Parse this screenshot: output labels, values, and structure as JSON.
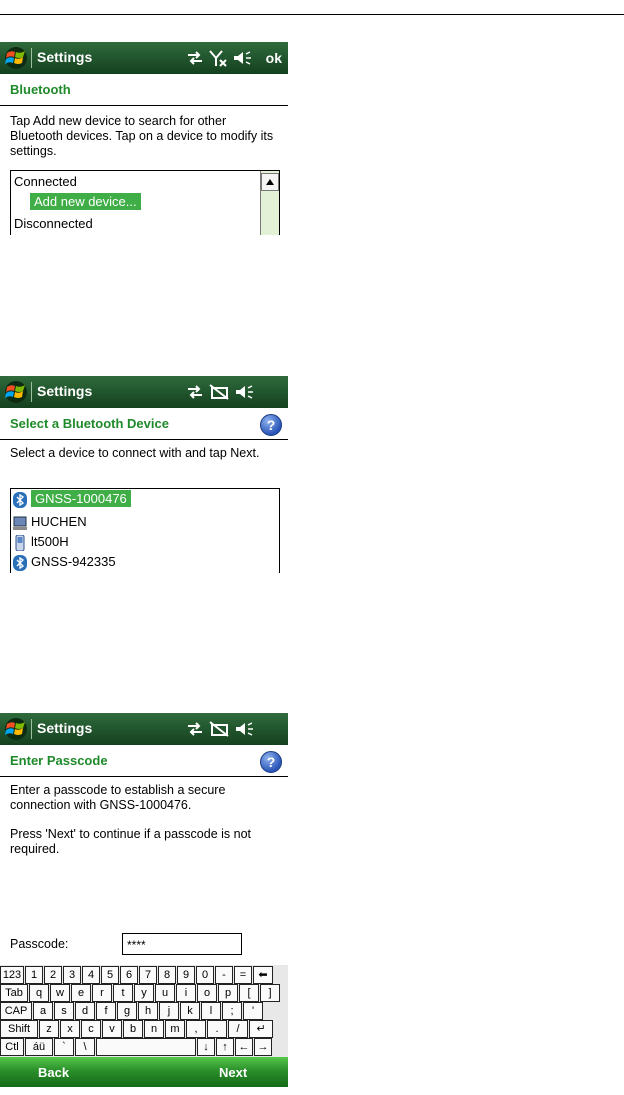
{
  "screens": {
    "bluetooth": {
      "title": "Settings",
      "ok_label": "ok",
      "heading": "Bluetooth",
      "instructions": "Tap Add new device to search for other Bluetooth devices. Tap on a device to modify its settings.",
      "list": [
        "Connected",
        "Add new device...",
        "Disconnected"
      ]
    },
    "select_device": {
      "title": "Settings",
      "heading": "Select a Bluetooth Device",
      "help_label": "?",
      "instructions": "Select a device to connect with and tap Next.",
      "devices": [
        {
          "name": "GNSS-1000476",
          "icon": "bluetooth-icon",
          "selected": true
        },
        {
          "name": "HUCHEN",
          "icon": "computer-icon",
          "selected": false
        },
        {
          "name": "lt500H",
          "icon": "handheld-icon",
          "selected": false
        },
        {
          "name": "GNSS-942335",
          "icon": "bluetooth-icon",
          "selected": false
        }
      ]
    },
    "passcode": {
      "title": "Settings",
      "heading": "Enter Passcode",
      "help_label": "?",
      "text1": "Enter a passcode to establish a secure connection with GNSS-1000476.",
      "text2": "Press 'Next' to continue if a passcode is not required.",
      "passcode_label": "Passcode:",
      "passcode_value": "****",
      "keyboard": {
        "row1": [
          "123",
          "1",
          "2",
          "3",
          "4",
          "5",
          "6",
          "7",
          "8",
          "9",
          "0",
          "-",
          "=",
          "⬅"
        ],
        "row2": [
          "Tab",
          "q",
          "w",
          "e",
          "r",
          "t",
          "y",
          "u",
          "i",
          "o",
          "p",
          "[",
          "]"
        ],
        "row3": [
          "CAP",
          "a",
          "s",
          "d",
          "f",
          "g",
          "h",
          "j",
          "k",
          "l",
          ";",
          "'"
        ],
        "row4": [
          "Shift",
          "z",
          "x",
          "c",
          "v",
          "b",
          "n",
          "m",
          ",",
          ".",
          "/",
          "↵"
        ],
        "row5": [
          "Ctl",
          "áü",
          "`",
          "\\",
          "",
          "↓",
          "↑",
          "←",
          "→"
        ]
      },
      "softkey_left": "Back",
      "softkey_right": "Next"
    }
  },
  "colors": {
    "titlebar": "#1e5a2b",
    "accent_green": "#1f8a2a",
    "highlight": "#3fae47"
  }
}
